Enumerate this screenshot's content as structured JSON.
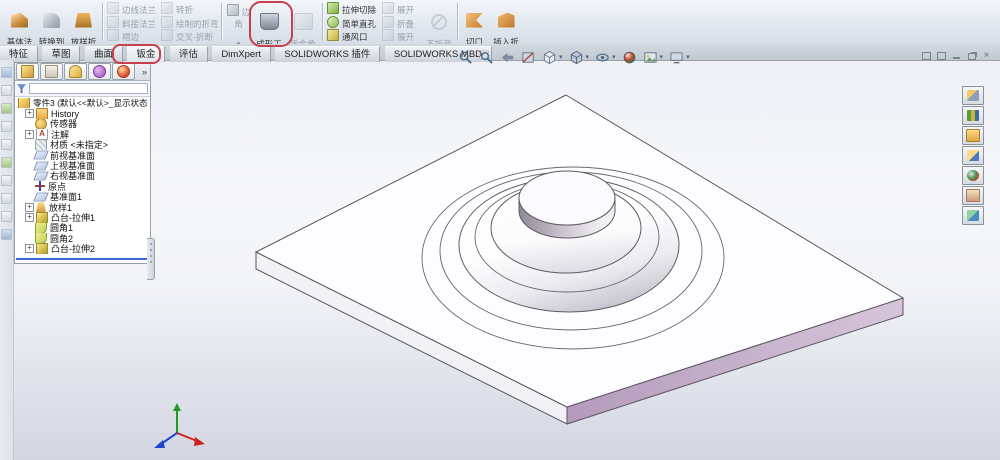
{
  "colors": {
    "highlight_red": "#c7404e",
    "plate_side_lavender": "#c9b2cf",
    "rollback_blue": "#3a6bd6"
  },
  "ribbon": {
    "groupA": [
      {
        "label": "基体法\n兰/薄片"
      },
      {
        "label": "转换到\n钣金"
      },
      {
        "label": "放样折\n弯"
      }
    ],
    "colFlange": [
      {
        "label": "边线法兰"
      },
      {
        "label": "斜接法兰"
      },
      {
        "label": "褶边"
      }
    ],
    "colJog": [
      {
        "label": "转折"
      },
      {
        "label": "绘制的折弯"
      },
      {
        "label": "交叉-折断"
      }
    ],
    "corner": {
      "label": "边角"
    },
    "formingTool": {
      "label": "成形工\n具"
    },
    "gusset": {
      "label": "钣金角\n撑板"
    },
    "colCut": [
      {
        "label": "拉伸切除"
      },
      {
        "label": "简单直孔"
      },
      {
        "label": "通风口"
      }
    ],
    "colFold": [
      {
        "label": "展开"
      },
      {
        "label": "折叠"
      },
      {
        "label": "展开"
      }
    ],
    "noBends": {
      "label": "不折弯"
    },
    "rip": {
      "label": "切口"
    },
    "insertBends": {
      "label": "插入折\n弯"
    }
  },
  "tabs": {
    "active": "钣金",
    "items": [
      {
        "label": "特征"
      },
      {
        "label": "草图"
      },
      {
        "label": "曲面"
      },
      {
        "label": "钣金"
      },
      {
        "label": "评估"
      },
      {
        "label": "DimXpert"
      },
      {
        "label": "SOLIDWORKS 插件"
      },
      {
        "label": "SOLIDWORKS MBD"
      }
    ]
  },
  "managerPanel": {
    "more_glyph": "»",
    "filter_value": ""
  },
  "featureTree": {
    "items": [
      {
        "label": "零件3 (默认<<默认>_显示状态",
        "icon": "part"
      },
      {
        "label": "History",
        "icon": "folder",
        "expandable": true
      },
      {
        "label": "传感器",
        "icon": "sensor"
      },
      {
        "label": "注解",
        "icon": "annotations",
        "expandable": true
      },
      {
        "label": "材质 <未指定>",
        "icon": "material"
      },
      {
        "label": "前视基准面",
        "icon": "plane"
      },
      {
        "label": "上视基准面",
        "icon": "plane"
      },
      {
        "label": "右视基准面",
        "icon": "plane"
      },
      {
        "label": "原点",
        "icon": "origin"
      },
      {
        "label": "基准面1",
        "icon": "plane"
      },
      {
        "label": "放样1",
        "icon": "loft",
        "expandable": true
      },
      {
        "label": "凸台-拉伸1",
        "icon": "boss-extrude",
        "expandable": true
      },
      {
        "label": "圆角1",
        "icon": "fillet"
      },
      {
        "label": "圆角2",
        "icon": "fillet"
      },
      {
        "label": "凸台-拉伸2",
        "icon": "boss-extrude",
        "expandable": true
      }
    ]
  },
  "headsUp": {
    "items": [
      {
        "name": "zoom-to-fit"
      },
      {
        "name": "zoom-to-area"
      },
      {
        "name": "previous-view"
      },
      {
        "name": "section-view"
      },
      {
        "name": "view-orientation",
        "dropdown": true
      },
      {
        "name": "display-style",
        "dropdown": true
      },
      {
        "name": "hide-show-items",
        "dropdown": true
      },
      {
        "name": "edit-appearance"
      },
      {
        "name": "apply-scene",
        "dropdown": true
      },
      {
        "name": "view-settings",
        "dropdown": true
      }
    ]
  },
  "windowControls": {
    "close_glyph": "×"
  },
  "taskpane": {
    "items": [
      {
        "name": "solidworks-resources"
      },
      {
        "name": "design-library"
      },
      {
        "name": "file-explorer"
      },
      {
        "name": "view-palette"
      },
      {
        "name": "appearances-scenes"
      },
      {
        "name": "custom-properties"
      },
      {
        "name": "document-recovery"
      }
    ]
  }
}
